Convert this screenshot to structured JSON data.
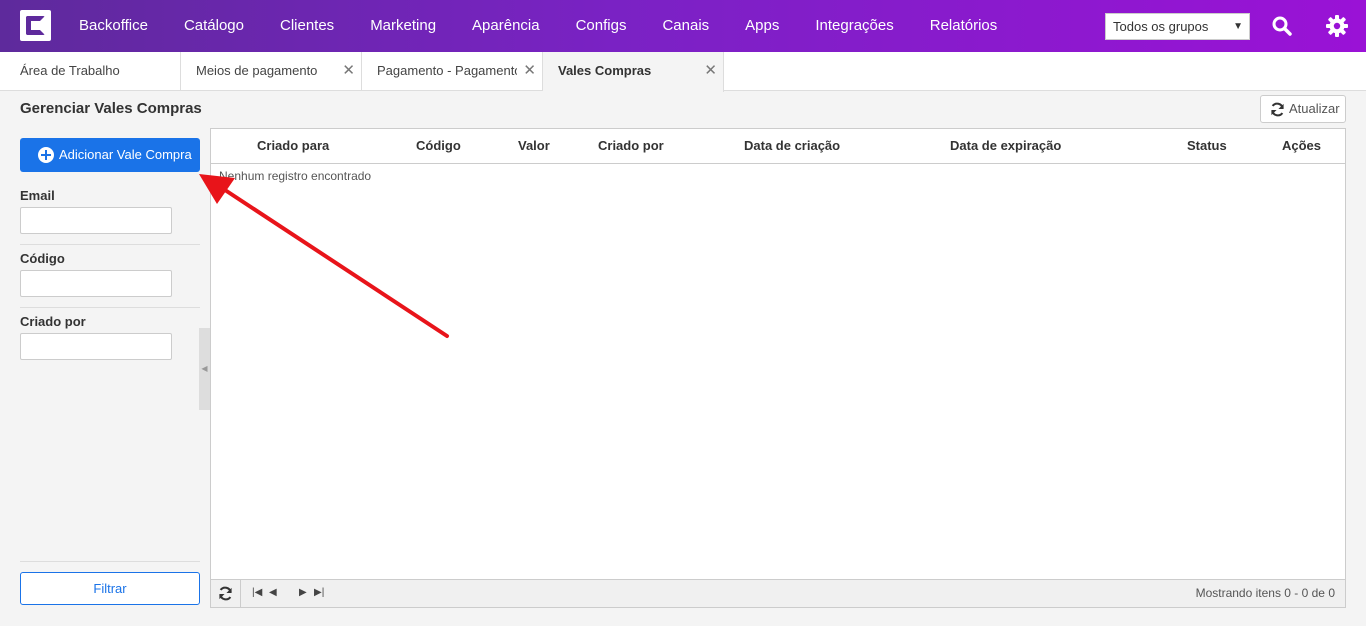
{
  "nav": {
    "items": [
      "Backoffice",
      "Catálogo",
      "Clientes",
      "Marketing",
      "Aparência",
      "Configs",
      "Canais",
      "Apps",
      "Integrações",
      "Relatórios"
    ],
    "group_select": "Todos os grupos",
    "search_icon": "search-icon",
    "settings_icon": "gear-icon"
  },
  "tabs": [
    {
      "label": "Área de Trabalho",
      "closable": false
    },
    {
      "label": "Meios de pagamento",
      "closable": true
    },
    {
      "label": "Pagamento - Pagamento c",
      "closable": true
    },
    {
      "label": "Vales Compras",
      "closable": true,
      "active": true
    }
  ],
  "page": {
    "title": "Gerenciar Vales Compras",
    "refresh_label": "Atualizar"
  },
  "sidebar": {
    "add_label": "Adicionar Vale Compra",
    "email_label": "Email",
    "code_label": "Código",
    "created_by_label": "Criado por",
    "filter_label": "Filtrar"
  },
  "grid": {
    "columns": [
      "Criado para",
      "Código",
      "Valor",
      "Criado por",
      "Data de criação",
      "Data de expiração",
      "Status",
      "Ações"
    ],
    "empty_message": "Nenhum registro encontrado",
    "pager_info": "Mostrando itens 0 - 0 de 0"
  },
  "colors": {
    "topbar_start": "#5e2a9c",
    "topbar_end": "#9a12d6",
    "primary": "#1a73e8",
    "annotation_arrow": "#e8141a"
  }
}
